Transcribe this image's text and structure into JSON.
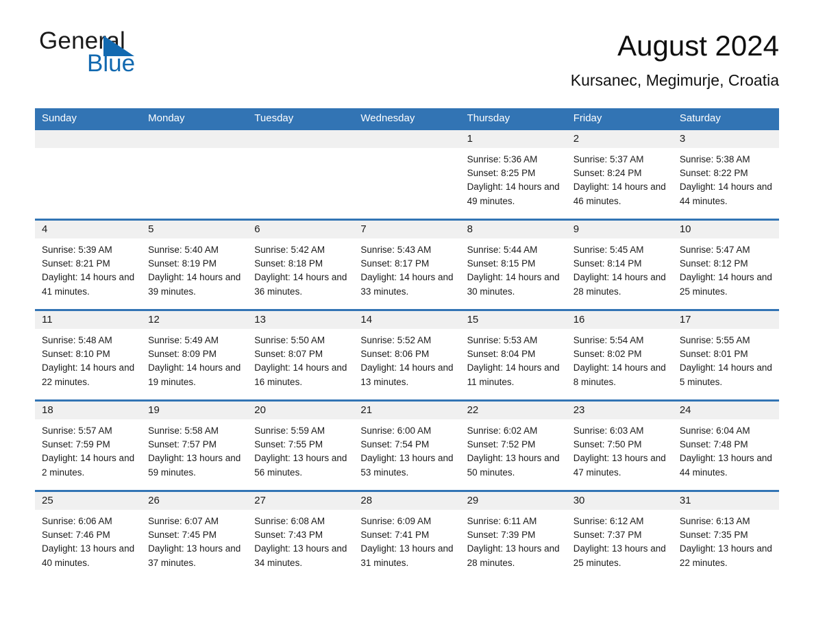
{
  "brand": {
    "line1": "General",
    "line2": "Blue",
    "triangle_icon": "triangle-icon",
    "accent_color": "#1269B0"
  },
  "header": {
    "month_title": "August 2024",
    "location": "Kursanec, Megimurje, Croatia"
  },
  "theme": {
    "header_blue": "#3274B4",
    "day_header_gray": "#f0f0f0",
    "text": "#1a1a1a"
  },
  "calendar": {
    "weekdays": [
      "Sunday",
      "Monday",
      "Tuesday",
      "Wednesday",
      "Thursday",
      "Friday",
      "Saturday"
    ],
    "weeks": [
      [
        {
          "day": "",
          "empty": true
        },
        {
          "day": "",
          "empty": true
        },
        {
          "day": "",
          "empty": true
        },
        {
          "day": "",
          "empty": true
        },
        {
          "day": "1",
          "sunrise": "Sunrise: 5:36 AM",
          "sunset": "Sunset: 8:25 PM",
          "daylight": "Daylight: 14 hours and 49 minutes."
        },
        {
          "day": "2",
          "sunrise": "Sunrise: 5:37 AM",
          "sunset": "Sunset: 8:24 PM",
          "daylight": "Daylight: 14 hours and 46 minutes."
        },
        {
          "day": "3",
          "sunrise": "Sunrise: 5:38 AM",
          "sunset": "Sunset: 8:22 PM",
          "daylight": "Daylight: 14 hours and 44 minutes."
        }
      ],
      [
        {
          "day": "4",
          "sunrise": "Sunrise: 5:39 AM",
          "sunset": "Sunset: 8:21 PM",
          "daylight": "Daylight: 14 hours and 41 minutes."
        },
        {
          "day": "5",
          "sunrise": "Sunrise: 5:40 AM",
          "sunset": "Sunset: 8:19 PM",
          "daylight": "Daylight: 14 hours and 39 minutes."
        },
        {
          "day": "6",
          "sunrise": "Sunrise: 5:42 AM",
          "sunset": "Sunset: 8:18 PM",
          "daylight": "Daylight: 14 hours and 36 minutes."
        },
        {
          "day": "7",
          "sunrise": "Sunrise: 5:43 AM",
          "sunset": "Sunset: 8:17 PM",
          "daylight": "Daylight: 14 hours and 33 minutes."
        },
        {
          "day": "8",
          "sunrise": "Sunrise: 5:44 AM",
          "sunset": "Sunset: 8:15 PM",
          "daylight": "Daylight: 14 hours and 30 minutes."
        },
        {
          "day": "9",
          "sunrise": "Sunrise: 5:45 AM",
          "sunset": "Sunset: 8:14 PM",
          "daylight": "Daylight: 14 hours and 28 minutes."
        },
        {
          "day": "10",
          "sunrise": "Sunrise: 5:47 AM",
          "sunset": "Sunset: 8:12 PM",
          "daylight": "Daylight: 14 hours and 25 minutes."
        }
      ],
      [
        {
          "day": "11",
          "sunrise": "Sunrise: 5:48 AM",
          "sunset": "Sunset: 8:10 PM",
          "daylight": "Daylight: 14 hours and 22 minutes."
        },
        {
          "day": "12",
          "sunrise": "Sunrise: 5:49 AM",
          "sunset": "Sunset: 8:09 PM",
          "daylight": "Daylight: 14 hours and 19 minutes."
        },
        {
          "day": "13",
          "sunrise": "Sunrise: 5:50 AM",
          "sunset": "Sunset: 8:07 PM",
          "daylight": "Daylight: 14 hours and 16 minutes."
        },
        {
          "day": "14",
          "sunrise": "Sunrise: 5:52 AM",
          "sunset": "Sunset: 8:06 PM",
          "daylight": "Daylight: 14 hours and 13 minutes."
        },
        {
          "day": "15",
          "sunrise": "Sunrise: 5:53 AM",
          "sunset": "Sunset: 8:04 PM",
          "daylight": "Daylight: 14 hours and 11 minutes."
        },
        {
          "day": "16",
          "sunrise": "Sunrise: 5:54 AM",
          "sunset": "Sunset: 8:02 PM",
          "daylight": "Daylight: 14 hours and 8 minutes."
        },
        {
          "day": "17",
          "sunrise": "Sunrise: 5:55 AM",
          "sunset": "Sunset: 8:01 PM",
          "daylight": "Daylight: 14 hours and 5 minutes."
        }
      ],
      [
        {
          "day": "18",
          "sunrise": "Sunrise: 5:57 AM",
          "sunset": "Sunset: 7:59 PM",
          "daylight": "Daylight: 14 hours and 2 minutes."
        },
        {
          "day": "19",
          "sunrise": "Sunrise: 5:58 AM",
          "sunset": "Sunset: 7:57 PM",
          "daylight": "Daylight: 13 hours and 59 minutes."
        },
        {
          "day": "20",
          "sunrise": "Sunrise: 5:59 AM",
          "sunset": "Sunset: 7:55 PM",
          "daylight": "Daylight: 13 hours and 56 minutes."
        },
        {
          "day": "21",
          "sunrise": "Sunrise: 6:00 AM",
          "sunset": "Sunset: 7:54 PM",
          "daylight": "Daylight: 13 hours and 53 minutes."
        },
        {
          "day": "22",
          "sunrise": "Sunrise: 6:02 AM",
          "sunset": "Sunset: 7:52 PM",
          "daylight": "Daylight: 13 hours and 50 minutes."
        },
        {
          "day": "23",
          "sunrise": "Sunrise: 6:03 AM",
          "sunset": "Sunset: 7:50 PM",
          "daylight": "Daylight: 13 hours and 47 minutes."
        },
        {
          "day": "24",
          "sunrise": "Sunrise: 6:04 AM",
          "sunset": "Sunset: 7:48 PM",
          "daylight": "Daylight: 13 hours and 44 minutes."
        }
      ],
      [
        {
          "day": "25",
          "sunrise": "Sunrise: 6:06 AM",
          "sunset": "Sunset: 7:46 PM",
          "daylight": "Daylight: 13 hours and 40 minutes."
        },
        {
          "day": "26",
          "sunrise": "Sunrise: 6:07 AM",
          "sunset": "Sunset: 7:45 PM",
          "daylight": "Daylight: 13 hours and 37 minutes."
        },
        {
          "day": "27",
          "sunrise": "Sunrise: 6:08 AM",
          "sunset": "Sunset: 7:43 PM",
          "daylight": "Daylight: 13 hours and 34 minutes."
        },
        {
          "day": "28",
          "sunrise": "Sunrise: 6:09 AM",
          "sunset": "Sunset: 7:41 PM",
          "daylight": "Daylight: 13 hours and 31 minutes."
        },
        {
          "day": "29",
          "sunrise": "Sunrise: 6:11 AM",
          "sunset": "Sunset: 7:39 PM",
          "daylight": "Daylight: 13 hours and 28 minutes."
        },
        {
          "day": "30",
          "sunrise": "Sunrise: 6:12 AM",
          "sunset": "Sunset: 7:37 PM",
          "daylight": "Daylight: 13 hours and 25 minutes."
        },
        {
          "day": "31",
          "sunrise": "Sunrise: 6:13 AM",
          "sunset": "Sunset: 7:35 PM",
          "daylight": "Daylight: 13 hours and 22 minutes."
        }
      ]
    ]
  }
}
